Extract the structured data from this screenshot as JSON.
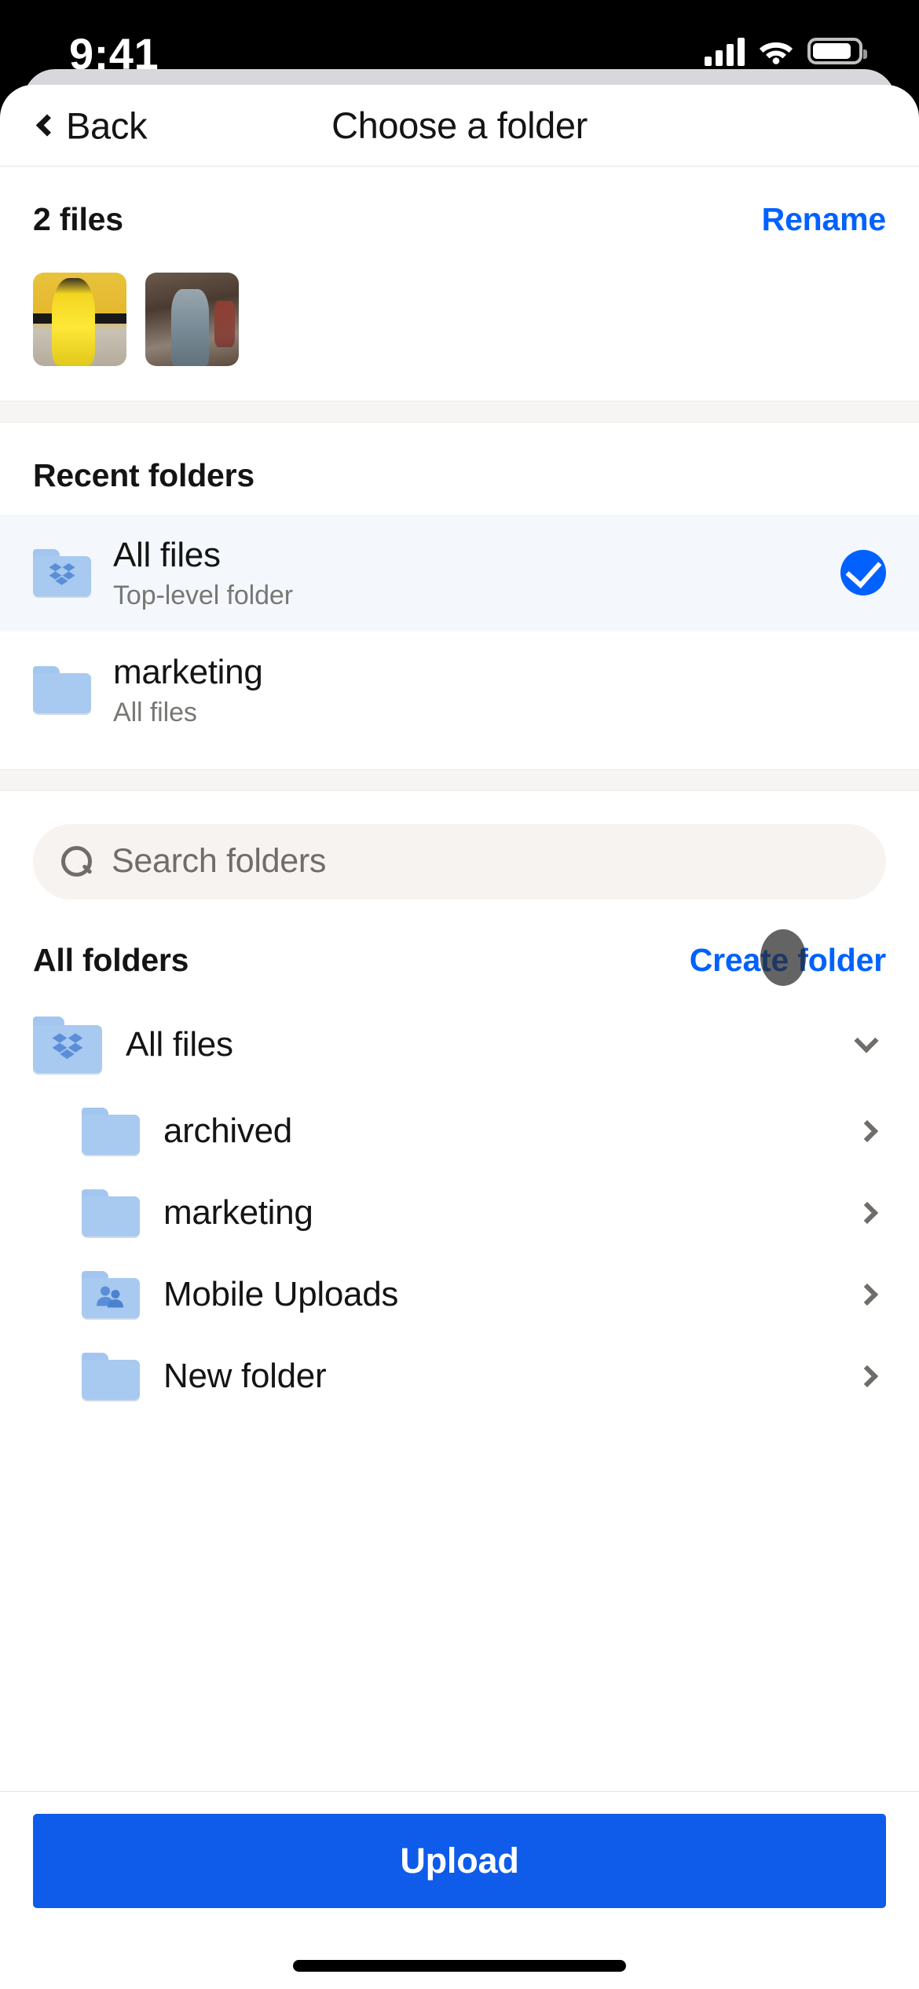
{
  "status_bar": {
    "time": "9:41",
    "signal_icon": "cellular-signal-icon",
    "wifi_icon": "wifi-icon",
    "battery_icon": "battery-icon"
  },
  "nav": {
    "back_label": "Back",
    "back_icon": "chevron-left-icon",
    "title": "Choose a folder"
  },
  "files": {
    "count_label": "2 files",
    "rename_label": "Rename",
    "thumbnails": [
      {
        "name": "photo-yellow-tracksuit"
      },
      {
        "name": "photo-denim-outfit"
      }
    ]
  },
  "recent": {
    "title": "Recent folders",
    "items": [
      {
        "name": "All files",
        "subtitle": "Top-level folder",
        "icon": "dropbox-folder-icon",
        "selected": true
      },
      {
        "name": "marketing",
        "subtitle": "All files",
        "icon": "folder-icon",
        "selected": false
      }
    ]
  },
  "search": {
    "placeholder": "Search folders",
    "value": "",
    "icon": "search-icon"
  },
  "all_folders": {
    "title": "All folders",
    "create_label": "Create folder",
    "tree": [
      {
        "name": "All files",
        "icon": "dropbox-folder-icon",
        "chevron": "chevron-down-icon",
        "indent": false
      },
      {
        "name": "archived",
        "icon": "folder-icon",
        "chevron": "chevron-right-icon",
        "indent": true
      },
      {
        "name": "marketing",
        "icon": "folder-icon",
        "chevron": "chevron-right-icon",
        "indent": true
      },
      {
        "name": "Mobile Uploads",
        "icon": "shared-folder-icon",
        "chevron": "chevron-right-icon",
        "indent": true
      },
      {
        "name": "New folder",
        "icon": "folder-icon",
        "chevron": "chevron-right-icon",
        "indent": true
      }
    ]
  },
  "footer": {
    "upload_label": "Upload"
  },
  "colors": {
    "accent_blue": "#0061fe",
    "button_blue": "#0f5ceb",
    "folder_blue": "#a8c9f0",
    "selected_row_bg": "#f4f8fd",
    "section_gap": "#f7f5f4",
    "search_bg": "#f7f3f1"
  }
}
